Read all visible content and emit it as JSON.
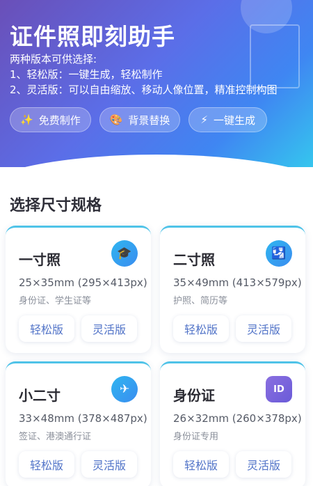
{
  "header": {
    "title": "证件照即刻助手",
    "intro": [
      "两种版本可供选择:",
      "1、轻松版：一键生成，轻松制作",
      "2、灵活版：可以自由缩放、移动人像位置，精准控制构图"
    ],
    "features": [
      {
        "icon": "sparkles-icon",
        "glyph": "✨",
        "label": "免费制作"
      },
      {
        "icon": "palette-icon",
        "glyph": "🎨",
        "label": "背景替换"
      },
      {
        "icon": "lightning-icon",
        "glyph": "⚡",
        "label": "一键生成"
      }
    ]
  },
  "section": {
    "title": "选择尺寸规格"
  },
  "sizes": [
    {
      "name": "一寸照",
      "spec": "25×35mm (295×413px)",
      "use": "身份证、学生证等",
      "icon": "graduation-cap-icon",
      "glyph": "🎓",
      "easy": "轻松版",
      "flex": "灵活版"
    },
    {
      "name": "二寸照",
      "spec": "35×49mm (413×579px)",
      "use": "护照、简历等",
      "icon": "passport-icon",
      "glyph": "🛂",
      "easy": "轻松版",
      "flex": "灵活版"
    },
    {
      "name": "小二寸",
      "spec": "33×48mm (378×487px)",
      "use": "签证、港澳通行证",
      "icon": "airplane-icon",
      "glyph": "✈",
      "easy": "轻松版",
      "flex": "灵活版"
    },
    {
      "name": "身份证",
      "spec": "26×32mm (260×378px)",
      "use": "身份证专用",
      "icon": "id-card-icon",
      "glyph": "ID",
      "easy": "轻松版",
      "flex": "灵活版"
    }
  ],
  "colors": {
    "accent": "#5274c8",
    "card_top": "#4fc3e8",
    "hero_start": "#6a4fb8",
    "hero_end": "#35c6ee"
  }
}
